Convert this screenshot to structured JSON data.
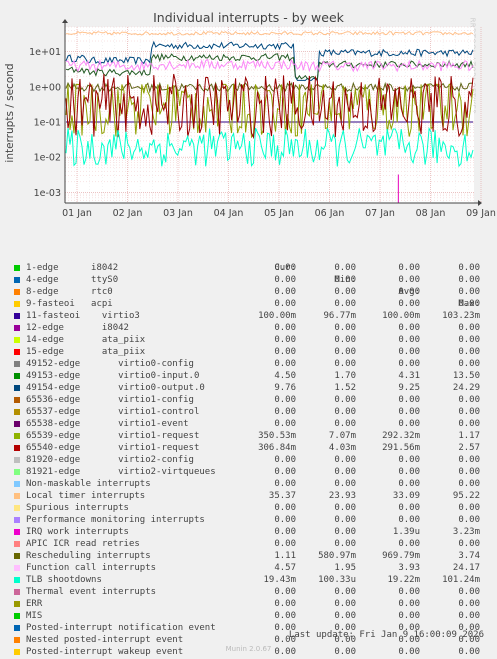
{
  "chart_data": {
    "type": "line",
    "title": "Individual interrupts - by week",
    "ylabel": "interrupts / second",
    "yscale": "log",
    "ylim": [
      0.0005,
      50
    ],
    "y_ticks": [
      {
        "v": 10,
        "label": "1e+01"
      },
      {
        "v": 1,
        "label": "1e+00"
      },
      {
        "v": 0.1,
        "label": "1e-01"
      },
      {
        "v": 0.01,
        "label": "1e-02"
      },
      {
        "v": 0.001,
        "label": "1e-03"
      }
    ],
    "x_ticks": [
      "01 Jan",
      "02 Jan",
      "03 Jan",
      "04 Jan",
      "05 Jan",
      "06 Jan",
      "07 Jan",
      "08 Jan",
      "09 Jan"
    ],
    "grid": true,
    "series": [
      {
        "name": "49154-edge virtio0-output.0",
        "color": "#00487e",
        "cur": 9.76,
        "min": 1.52,
        "avg": 9.25,
        "max": 24.29
      },
      {
        "name": "49153-edge virtio0-input.0",
        "color": "#235a23",
        "cur": 4.5,
        "min": 1.7,
        "avg": 4.31,
        "max": 13.5
      },
      {
        "name": "Local timer interrupts",
        "color": "#ffc08a",
        "cur": 35.37,
        "min": 23.93,
        "avg": 33.09,
        "max": 95.22
      },
      {
        "name": "Function call interrupts",
        "color": "#fb88f8",
        "cur": 4.57,
        "min": 1.95,
        "avg": 3.93,
        "max": 24.17
      },
      {
        "name": "Rescheduling interrupts",
        "color": "#5e6516",
        "cur": 1.11,
        "min": 0.58097,
        "avg": 0.96979,
        "max": 3.74
      },
      {
        "name": "11-fasteoi virtio3",
        "color": "#320081",
        "cur": 0.1,
        "min": 0.09677,
        "avg": 0.1,
        "max": 0.10323
      },
      {
        "name": "65539-edge virtio1-request",
        "color": "#8fa000",
        "cur": 0.35053,
        "min": 0.00707,
        "avg": 0.29232,
        "max": 1.17
      },
      {
        "name": "65540-edge virtio1-request",
        "color": "#990000",
        "cur": 0.30684,
        "min": 0.00403,
        "avg": 0.29156,
        "max": 2.57
      },
      {
        "name": "TLB shootdowns",
        "color": "#00ffcc",
        "cur": 0.01943,
        "min": 0.00010033,
        "avg": 0.01922,
        "max": 0.10124
      },
      {
        "name": "IRQ work interrupts",
        "color": "#e600bb",
        "cur": 0,
        "min": 0,
        "avg": 1.39e-06,
        "max": 0.00323
      }
    ]
  },
  "legend": {
    "headers": {
      "cur": "Cur:",
      "min": "Min:",
      "avg": "Avg:",
      "max": "Max:"
    },
    "rows": [
      {
        "color": "#00cc00",
        "label": "1-edge      i8042",
        "cur": "0.00",
        "min": "0.00",
        "avg": "0.00",
        "max": "0.00"
      },
      {
        "color": "#0066b3",
        "label": "4-edge      ttyS0",
        "cur": "0.00",
        "min": "0.00",
        "avg": "0.00",
        "max": "0.00"
      },
      {
        "color": "#ff8000",
        "label": "8-edge      rtc0",
        "cur": "0.00",
        "min": "0.00",
        "avg": "0.00",
        "max": "0.00"
      },
      {
        "color": "#ffcc00",
        "label": "9-fasteoi   acpi",
        "cur": "0.00",
        "min": "0.00",
        "avg": "0.00",
        "max": "0.00"
      },
      {
        "color": "#330099",
        "label": "11-fasteoi    virtio3",
        "cur": "100.00m",
        "min": "96.77m",
        "avg": "100.00m",
        "max": "103.23m"
      },
      {
        "color": "#990099",
        "label": "12-edge       i8042",
        "cur": "0.00",
        "min": "0.00",
        "avg": "0.00",
        "max": "0.00"
      },
      {
        "color": "#ccff00",
        "label": "14-edge       ata_piix",
        "cur": "0.00",
        "min": "0.00",
        "avg": "0.00",
        "max": "0.00"
      },
      {
        "color": "#ff0000",
        "label": "15-edge       ata_piix",
        "cur": "0.00",
        "min": "0.00",
        "avg": "0.00",
        "max": "0.00"
      },
      {
        "color": "#808080",
        "label": "49152-edge       virtio0-config",
        "cur": "0.00",
        "min": "0.00",
        "avg": "0.00",
        "max": "0.00"
      },
      {
        "color": "#008f00",
        "label": "49153-edge       virtio0-input.0",
        "cur": "4.50",
        "min": "1.70",
        "avg": "4.31",
        "max": "13.50"
      },
      {
        "color": "#00487d",
        "label": "49154-edge       virtio0-output.0",
        "cur": "9.76",
        "min": "1.52",
        "avg": "9.25",
        "max": "24.29"
      },
      {
        "color": "#b35a00",
        "label": "65536-edge       virtio1-config",
        "cur": "0.00",
        "min": "0.00",
        "avg": "0.00",
        "max": "0.00"
      },
      {
        "color": "#b38f00",
        "label": "65537-edge       virtio1-control",
        "cur": "0.00",
        "min": "0.00",
        "avg": "0.00",
        "max": "0.00"
      },
      {
        "color": "#6b006b",
        "label": "65538-edge       virtio1-event",
        "cur": "0.00",
        "min": "0.00",
        "avg": "0.00",
        "max": "0.00"
      },
      {
        "color": "#8fb300",
        "label": "65539-edge       virtio1-request",
        "cur": "350.53m",
        "min": "7.07m",
        "avg": "292.32m",
        "max": "1.17"
      },
      {
        "color": "#b30000",
        "label": "65540-edge       virtio1-request",
        "cur": "306.84m",
        "min": "4.03m",
        "avg": "291.56m",
        "max": "2.57"
      },
      {
        "color": "#bebebe",
        "label": "81920-edge       virtio2-config",
        "cur": "0.00",
        "min": "0.00",
        "avg": "0.00",
        "max": "0.00"
      },
      {
        "color": "#80ff80",
        "label": "81921-edge       virtio2-virtqueues",
        "cur": "0.00",
        "min": "0.00",
        "avg": "0.00",
        "max": "0.00"
      },
      {
        "color": "#80c9ff",
        "label": "Non-maskable interrupts",
        "cur": "0.00",
        "min": "0.00",
        "avg": "0.00",
        "max": "0.00"
      },
      {
        "color": "#ffc080",
        "label": "Local timer interrupts",
        "cur": "35.37",
        "min": "23.93",
        "avg": "33.09",
        "max": "95.22"
      },
      {
        "color": "#ffe680",
        "label": "Spurious interrupts",
        "cur": "0.00",
        "min": "0.00",
        "avg": "0.00",
        "max": "0.00"
      },
      {
        "color": "#aa80ff",
        "label": "Performance monitoring interrupts",
        "cur": "0.00",
        "min": "0.00",
        "avg": "0.00",
        "max": "0.00"
      },
      {
        "color": "#ee00cc",
        "label": "IRQ work interrupts",
        "cur": "0.00",
        "min": "0.00",
        "avg": "1.39u",
        "max": "3.23m"
      },
      {
        "color": "#ff8080",
        "label": "APIC ICR read retries",
        "cur": "0.00",
        "min": "0.00",
        "avg": "0.00",
        "max": "0.00"
      },
      {
        "color": "#666600",
        "label": "Rescheduling interrupts",
        "cur": "1.11",
        "min": "580.97m",
        "avg": "969.79m",
        "max": "3.74"
      },
      {
        "color": "#ffbfff",
        "label": "Function call interrupts",
        "cur": "4.57",
        "min": "1.95",
        "avg": "3.93",
        "max": "24.17"
      },
      {
        "color": "#00ffcc",
        "label": "TLB shootdowns",
        "cur": "19.43m",
        "min": "100.33u",
        "avg": "19.22m",
        "max": "101.24m"
      },
      {
        "color": "#cc6699",
        "label": "Thermal event interrupts",
        "cur": "0.00",
        "min": "0.00",
        "avg": "0.00",
        "max": "0.00"
      },
      {
        "color": "#999900",
        "label": "ERR",
        "cur": "0.00",
        "min": "0.00",
        "avg": "0.00",
        "max": "0.00"
      },
      {
        "color": "#00cc00",
        "label": "MIS",
        "cur": "0.00",
        "min": "0.00",
        "avg": "0.00",
        "max": "0.00"
      },
      {
        "color": "#0066b3",
        "label": "Posted-interrupt notification event",
        "cur": "0.00",
        "min": "0.00",
        "avg": "0.00",
        "max": "0.00"
      },
      {
        "color": "#ff8000",
        "label": "Nested posted-interrupt event",
        "cur": "0.00",
        "min": "0.00",
        "avg": "0.00",
        "max": "0.00"
      },
      {
        "color": "#ffcc00",
        "label": "Posted-interrupt wakeup event",
        "cur": "0.00",
        "min": "0.00",
        "avg": "0.00",
        "max": "0.00"
      }
    ]
  },
  "footer": {
    "last_update": "Last update: Fri Jan  9 16:00:09 2026",
    "munin": "Munin 2.0.67"
  },
  "side_text": "RRDTOOL / TOBI OETIKER"
}
